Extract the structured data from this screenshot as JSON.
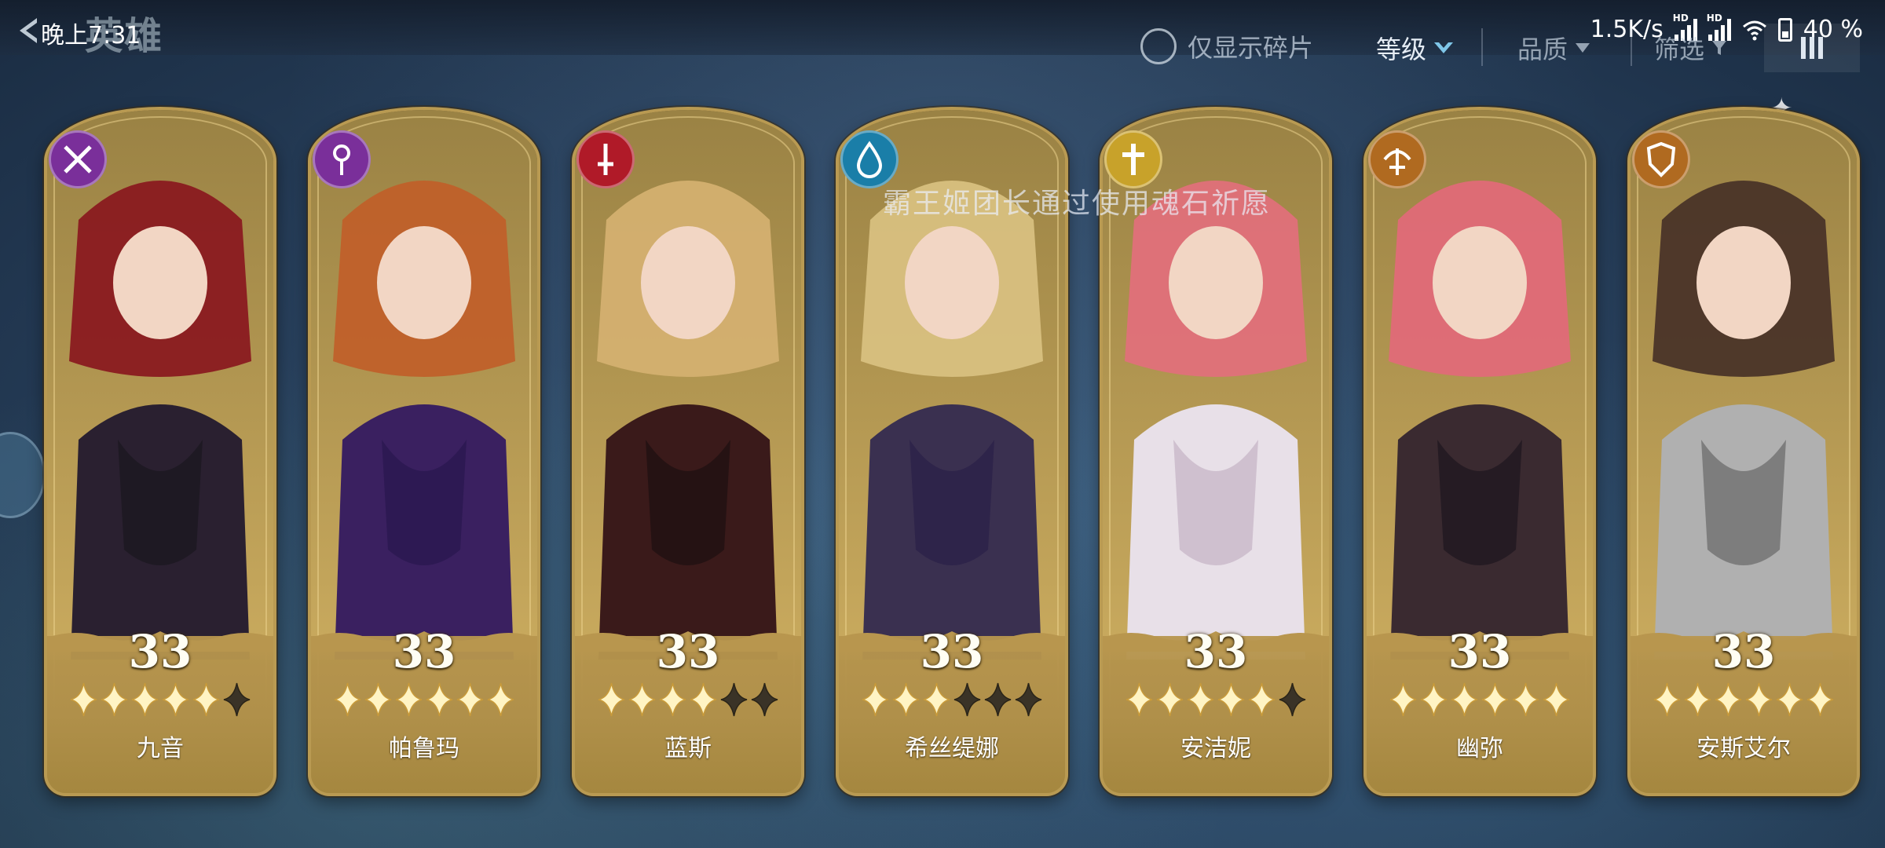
{
  "status_bar": {
    "time": "晚上7:31",
    "network_speed": "1.5K/s",
    "hd_badge_1": "HD",
    "hd_badge_2": "HD",
    "battery": "40 %"
  },
  "header": {
    "title": "英雄",
    "fragment_toggle_label": "仅显示碎片",
    "sort_level_label": "等级",
    "sort_quality_label": "品质",
    "filter_label": "筛选",
    "back_icon": "back-arrow-icon",
    "menu_icon": "menu-bars-icon"
  },
  "toast": {
    "text": "霸王姬团长通过使用魂石祈愿"
  },
  "colors": {
    "accent_gold": "#b99a52",
    "star_filled": "#fff4c4",
    "star_empty": "#3a3327"
  },
  "heroes": [
    {
      "name": "九音",
      "level": "33",
      "stars": 5,
      "max_stars": 6,
      "class_icon": "crossed-blades-icon",
      "badge_color": "#7a2f9a"
    },
    {
      "name": "帕鲁玛",
      "level": "33",
      "stars": 6,
      "max_stars": 6,
      "class_icon": "magic-staff-icon",
      "badge_color": "#7a2f9a"
    },
    {
      "name": "蓝斯",
      "level": "33",
      "stars": 4,
      "max_stars": 6,
      "class_icon": "sword-icon",
      "badge_color": "#b01a28"
    },
    {
      "name": "希丝缇娜",
      "level": "33",
      "stars": 3,
      "max_stars": 6,
      "class_icon": "water-drop-icon",
      "badge_color": "#1a7ea8"
    },
    {
      "name": "安洁妮",
      "level": "33",
      "stars": 5,
      "max_stars": 6,
      "class_icon": "holy-cross-icon",
      "badge_color": "#c8a22a"
    },
    {
      "name": "幽弥",
      "level": "33",
      "stars": 6,
      "max_stars": 6,
      "class_icon": "crossbow-icon",
      "badge_color": "#b06a20"
    },
    {
      "name": "安斯艾尔",
      "level": "33",
      "stars": 6,
      "max_stars": 6,
      "class_icon": "shield-icon",
      "badge_color": "#b06a20"
    }
  ]
}
